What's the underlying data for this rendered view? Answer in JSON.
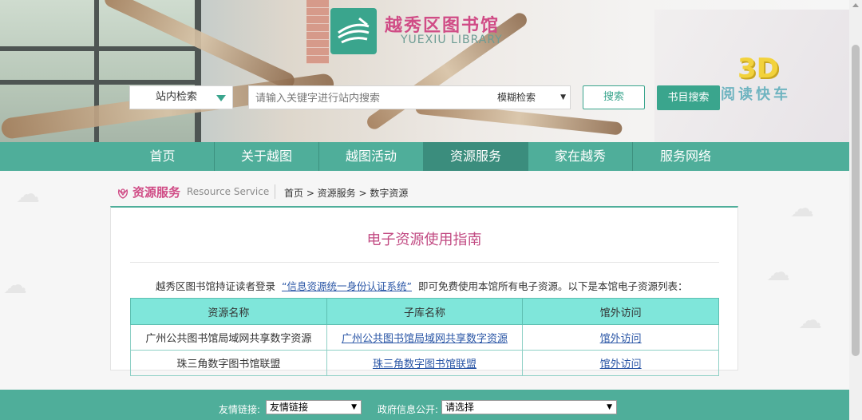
{
  "header": {
    "logo_cn": "越秀区图书馆",
    "logo_en": "YUEXIU LIBRARY",
    "promo_3d": "3D",
    "promo_text": "阅读快车"
  },
  "search": {
    "scope_value": "站内检索",
    "placeholder": "请输入关键字进行站内搜索",
    "mode_value": "模糊检索",
    "search_button": "搜索",
    "catalog_button": "书目搜索"
  },
  "nav": {
    "items": [
      {
        "label": "首页"
      },
      {
        "label": "关于越图"
      },
      {
        "label": "越图活动"
      },
      {
        "label": "资源服务"
      },
      {
        "label": "家在越秀"
      },
      {
        "label": "服务网络"
      }
    ],
    "active_index": 3
  },
  "section": {
    "title_cn": "资源服务",
    "title_en": "Resource Service",
    "breadcrumb": "首页 > 资源服务 > 数字资源"
  },
  "panel": {
    "title": "电子资源使用指南",
    "intro_before": "越秀区图书馆持证读者登录",
    "intro_link": "“信息资源统一身份认证系统”",
    "intro_after": "即可免费使用本馆所有电子资源。以下是本馆电子资源列表：",
    "table": {
      "headers": [
        "资源名称",
        "子库名称",
        "馆外访问"
      ],
      "rows": [
        [
          "广州公共图书馆局域网共享数字资源",
          "广州公共图书馆局域网共享数字资源",
          "馆外访问"
        ],
        [
          "珠三角数字图书馆联盟",
          "珠三角数字图书馆联盟",
          "馆外访问"
        ]
      ]
    }
  },
  "footer": {
    "links_label": "友情链接:",
    "links_value": "友情链接",
    "gov_label": "政府信息公开:",
    "gov_value": "请选择"
  },
  "colors": {
    "brand_green": "#4fae9a",
    "accent_pink": "#d04c86",
    "table_header": "#7fe6da"
  }
}
